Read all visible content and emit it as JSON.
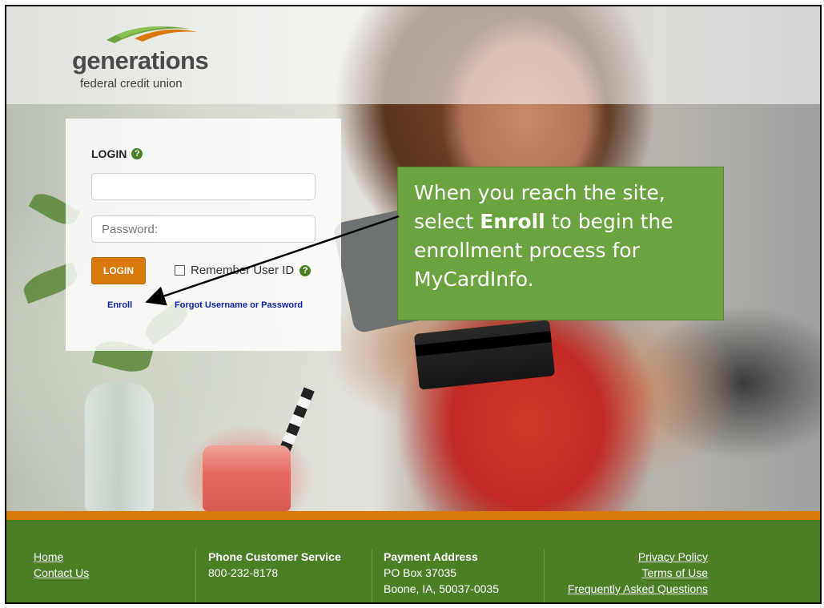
{
  "logo": {
    "name": "generations",
    "subtitle": "federal credit union"
  },
  "login": {
    "title": "LOGIN",
    "username_value": "",
    "password_placeholder": "Password:",
    "button_label": "LOGIN",
    "remember_label": "Remember User ID",
    "enroll_link": "Enroll",
    "forgot_link": "Forgot Username or Password"
  },
  "callout": {
    "line_before": "When you reach the site, select",
    "highlight": "Enroll",
    "line_after": "to begin the enrollment process for MyCardInfo."
  },
  "footer": {
    "nav": [
      "Home",
      "Contact Us"
    ],
    "phone_heading": "Phone Customer Service",
    "phone_number": "800-232-8178",
    "payment_heading": "Payment Address",
    "payment_line1": "PO Box 37035",
    "payment_line2": "Boone, IA, 50037-0035",
    "legal": [
      "Privacy Policy",
      "Terms of Use",
      "Frequently Asked Questions"
    ]
  },
  "colors": {
    "brand_green": "#4a7f25",
    "accent_orange": "#d9790a",
    "callout_green": "#6aa33f",
    "link_blue": "#0b1fa3"
  }
}
